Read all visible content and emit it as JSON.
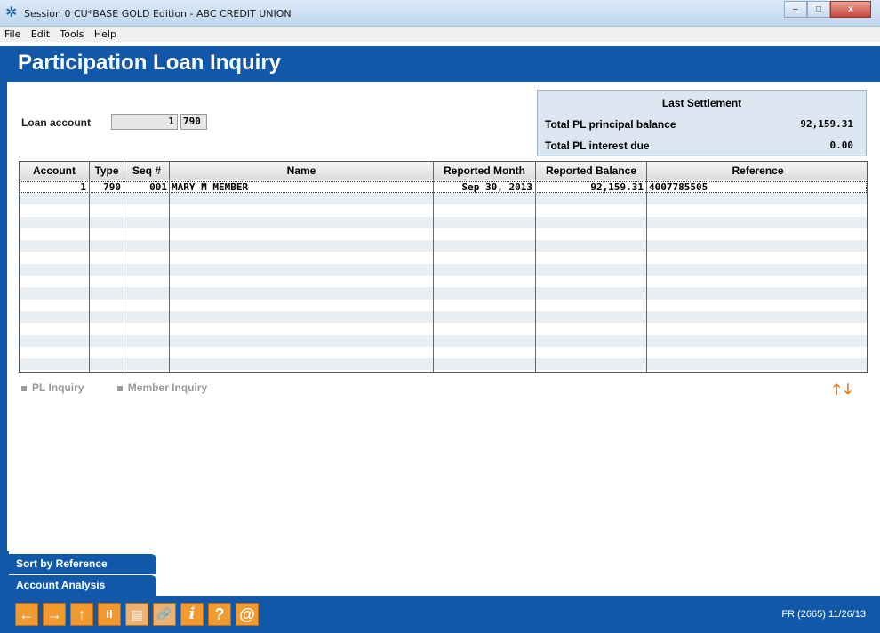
{
  "window": {
    "title": "Session 0 CU*BASE GOLD Edition - ABC CREDIT UNION",
    "minimize": "–",
    "maximize": "□",
    "close": "x"
  },
  "menu": [
    "File",
    "Edit",
    "Tools",
    "Help"
  ],
  "page_title": "Participation Loan Inquiry",
  "loan_account": {
    "label": "Loan account",
    "account": "1",
    "suffix": "790"
  },
  "settlement": {
    "title": "Last Settlement",
    "principal_label": "Total PL principal balance",
    "principal_value": "92,159.31",
    "interest_label": "Total PL interest due",
    "interest_value": "0.00"
  },
  "table": {
    "headers": [
      "Account",
      "Type",
      "Seq #",
      "Name",
      "Reported Month",
      "Reported Balance",
      "Reference"
    ],
    "rows": [
      {
        "account": "1",
        "type": "790",
        "seq": "001",
        "name": "MARY M MEMBER",
        "month": "Sep 30, 2013",
        "balance": "92,159.31",
        "reference": "4007785505"
      }
    ]
  },
  "links": {
    "pl_inquiry": "PL Inquiry",
    "member_inquiry": "Member Inquiry"
  },
  "commands": {
    "sort_by_reference": "Sort by Reference",
    "account_analysis": "Account Analysis"
  },
  "toolbar": {
    "back": "←",
    "forward": "→",
    "up": "↑",
    "pause": "II",
    "print": "▤",
    "link": "🔗",
    "info": "i",
    "help": "?",
    "email": "@"
  },
  "status_text": "FR (2665) 11/26/13",
  "colors": {
    "brand_blue": "#1158a8",
    "accent_orange": "#f09a30"
  }
}
